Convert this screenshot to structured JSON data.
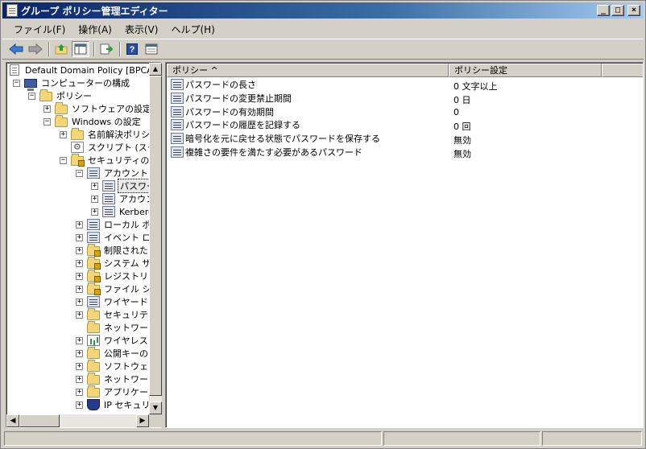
{
  "window": {
    "title": "グループ ポリシー管理エディター"
  },
  "menu": [
    "ファイル(F)",
    "操作(A)",
    "表示(V)",
    "ヘルプ(H)"
  ],
  "toolbar": {
    "icons": [
      "back-arrow-icon",
      "forward-arrow-icon",
      "up-folder-icon",
      "show-hide-tree-icon",
      "export-list-icon",
      "help-icon",
      "properties-icon"
    ]
  },
  "tree": {
    "nodes": [
      {
        "label": "Default Domain Policy [BPCA",
        "expander": "",
        "icon": "policy-doc"
      },
      {
        "label": "コンピューターの構成",
        "expander": "−",
        "icon": "computer"
      },
      {
        "label": "ポリシー",
        "expander": "−",
        "icon": "folder"
      },
      {
        "label": "ソフトウェアの設定",
        "expander": "+",
        "icon": "folder"
      },
      {
        "label": "Windows の設定",
        "expander": "−",
        "icon": "folder"
      },
      {
        "label": "名前解決ポリシ",
        "expander": "+",
        "icon": "folder"
      },
      {
        "label": "スクリプト (スター",
        "expander": "",
        "icon": "script"
      },
      {
        "label": "セキュリティの設",
        "expander": "−",
        "icon": "lockfolder"
      },
      {
        "label": "アカウント ポ",
        "expander": "−",
        "icon": "policy"
      },
      {
        "label": "パスワー",
        "expander": "+",
        "icon": "policy"
      },
      {
        "label": "アカウン",
        "expander": "+",
        "icon": "policy"
      },
      {
        "label": "Kerbero",
        "expander": "+",
        "icon": "policy"
      },
      {
        "label": "ローカル ポリ",
        "expander": "+",
        "icon": "policy"
      },
      {
        "label": "イベント ログ",
        "expander": "+",
        "icon": "policy"
      },
      {
        "label": "制限された",
        "expander": "+",
        "icon": "lockfolder"
      },
      {
        "label": "システム サ",
        "expander": "+",
        "icon": "lockfolder"
      },
      {
        "label": "レジストリ",
        "expander": "+",
        "icon": "lockfolder"
      },
      {
        "label": "ファイル シス",
        "expander": "+",
        "icon": "lockfolder"
      },
      {
        "label": "ワイヤード (",
        "expander": "+",
        "icon": "policy"
      },
      {
        "label": "セキュリティ",
        "expander": "+",
        "icon": "folder"
      },
      {
        "label": "ネットワーク",
        "expander": "",
        "icon": "folder"
      },
      {
        "label": "ワイヤレス ネ",
        "expander": "+",
        "icon": "chart"
      },
      {
        "label": "公開キーの",
        "expander": "+",
        "icon": "folder"
      },
      {
        "label": "ソフトウェア",
        "expander": "+",
        "icon": "folder"
      },
      {
        "label": "ネットワーク",
        "expander": "+",
        "icon": "folder"
      },
      {
        "label": "アプリケーシ",
        "expander": "+",
        "icon": "folder"
      },
      {
        "label": "IP セキュリテ",
        "expander": "+",
        "icon": "shield"
      }
    ]
  },
  "list": {
    "columns": [
      "ポリシー ^",
      "ポリシー設定"
    ],
    "rows": [
      {
        "policy": "パスワードの長さ",
        "setting": "0 文字以上"
      },
      {
        "policy": "パスワードの変更禁止期間",
        "setting": "0 日"
      },
      {
        "policy": "パスワードの有効期間",
        "setting": "0"
      },
      {
        "policy": "パスワードの履歴を記録する",
        "setting": "0 回"
      },
      {
        "policy": "暗号化を元に戻せる状態でパスワードを保存する",
        "setting": "無効"
      },
      {
        "policy": "複雑さの要件を満たす必要があるパスワード",
        "setting": "無効"
      }
    ]
  }
}
